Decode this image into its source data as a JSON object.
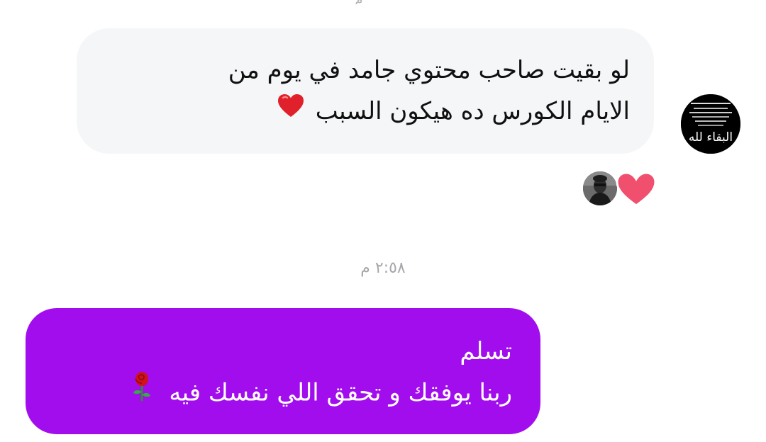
{
  "conversation": {
    "incoming": {
      "lines": [
        "لو بقيت صاحب محتوي جامد في يوم من",
        "الايام الكورس ده هيكون السبب"
      ],
      "emoji": "red-heart",
      "sender_avatar_text": "البقاء لله",
      "reaction": "heart"
    },
    "timestamp": "٢:٥٨ م",
    "outgoing": {
      "lines": [
        "تسلم",
        "ربنا يوفقك و تحقق اللي نفسك فيه"
      ],
      "emoji": "rose"
    }
  },
  "colors": {
    "incoming_bubble": "#f5f6f8",
    "outgoing_bubble": "#a20ded",
    "reaction_heart": "#f0506e",
    "timestamp": "#a6a6ab"
  }
}
